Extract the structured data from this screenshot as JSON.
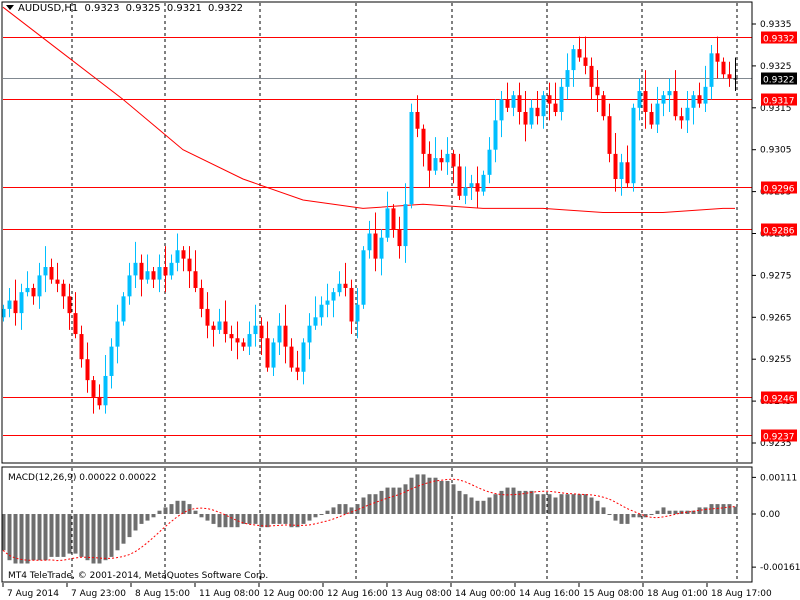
{
  "header": {
    "symbol": "AUDUSD,H1",
    "open": "0.9323",
    "high": "0.9325",
    "low": "0.9321",
    "close": "0.9322"
  },
  "macd_header": "MACD(12,26,9) 0.00022 0.00022",
  "copyright": "MT4 TeleTrade, © 2001-2014, MetaQuotes Software Corp.",
  "colors": {
    "bull": "#00BFFF",
    "bear": "#FF0000",
    "doji": "#000000",
    "level": "#FF0000",
    "current": "#808890",
    "histogram": "#6E6E6E",
    "signal": "#FF0000"
  },
  "chart_data": [
    {
      "type": "candlestick",
      "title": "AUDUSD,H1",
      "ylim": [
        0.9232,
        0.934
      ],
      "y_ticks": [
        "0.9335",
        "0.9325",
        "0.9315",
        "0.9305",
        "0.9295",
        "0.9285",
        "0.9275",
        "0.9265",
        "0.9255",
        "0.9245",
        "0.9235"
      ],
      "x_ticks": [
        "7 Aug 2014",
        "7 Aug 23:00",
        "8 Aug 15:00",
        "11 Aug 08:00",
        "12 Aug 00:00",
        "12 Aug 16:00",
        "13 Aug 08:00",
        "14 Aug 00:00",
        "14 Aug 16:00",
        "15 Aug 08:00",
        "18 Aug 01:00",
        "18 Aug 17:00"
      ],
      "first_open": 0.9265,
      "close": [
        0.9267,
        0.9269,
        0.9266,
        0.9271,
        0.9272,
        0.927,
        0.9275,
        0.9277,
        0.9274,
        0.9273,
        0.927,
        0.9266,
        0.9261,
        0.9255,
        0.925,
        0.9246,
        0.9244,
        0.9251,
        0.9258,
        0.9264,
        0.927,
        0.9275,
        0.9278,
        0.9274,
        0.9276,
        0.9274,
        0.9277,
        0.9275,
        0.9278,
        0.9281,
        0.9279,
        0.9276,
        0.9272,
        0.9267,
        0.9263,
        0.9262,
        0.9264,
        0.9261,
        0.926,
        0.9259,
        0.9258,
        0.9261,
        0.9263,
        0.926,
        0.9253,
        0.9259,
        0.9263,
        0.9258,
        0.9253,
        0.9252,
        0.9259,
        0.9263,
        0.9265,
        0.9268,
        0.9269,
        0.9271,
        0.9273,
        0.9272,
        0.9264,
        0.9268,
        0.9281,
        0.9285,
        0.9279,
        0.9284,
        0.9291,
        0.9286,
        0.9282,
        0.9292,
        0.9314,
        0.931,
        0.9304,
        0.93,
        0.9303,
        0.9302,
        0.9304,
        0.9301,
        0.9294,
        0.9296,
        0.9297,
        0.9295,
        0.9299,
        0.9305,
        0.9312,
        0.9317,
        0.9315,
        0.9318,
        0.9314,
        0.9311,
        0.9315,
        0.9313,
        0.9318,
        0.9316,
        0.9314,
        0.932,
        0.9324,
        0.9329,
        0.9327,
        0.9325,
        0.932,
        0.9318,
        0.9313,
        0.9304,
        0.9298,
        0.9302,
        0.9297,
        0.9315,
        0.9319,
        0.9314,
        0.9311,
        0.9316,
        0.9318,
        0.9319,
        0.9313,
        0.9312,
        0.9315,
        0.9318,
        0.9316,
        0.932,
        0.9328,
        0.9326,
        0.9323,
        0.9322,
        0.9322
      ],
      "moving_average": {
        "sample_every_bars": 10,
        "values": [
          0.9339,
          0.9328,
          0.9317,
          0.9305,
          0.9298,
          0.9293,
          0.9291,
          0.9292,
          0.9291,
          0.9291,
          0.929,
          0.929,
          0.9291,
          0.9291
        ]
      },
      "levels": [
        "0.9332",
        "0.9317",
        "0.9296",
        "0.9286",
        "0.9246",
        "0.9237"
      ],
      "current_price": "0.9322"
    },
    {
      "type": "bar",
      "title": "MACD(12,26,9)",
      "ylim": [
        -0.00161,
        0.00111
      ],
      "y_ticks": [
        "0.00111",
        "0.00",
        "-0.00161"
      ],
      "signal_period": 9,
      "macd": [
        -0.0011,
        -0.0014,
        -0.0015,
        -0.0015,
        -0.0015,
        -0.0014,
        -0.0014,
        -0.0014,
        -0.0013,
        -0.0013,
        -0.0013,
        -0.0012,
        -0.0012,
        -0.0013,
        -0.0014,
        -0.0015,
        -0.0015,
        -0.0014,
        -0.0013,
        -0.0011,
        -0.0009,
        -0.0007,
        -0.0005,
        -0.0003,
        -0.0002,
        -0.0001,
        0.0001,
        0.0002,
        0.0003,
        0.0004,
        0.0004,
        0.0003,
        0.0001,
        -0.0001,
        -0.0002,
        -0.0003,
        -0.0004,
        -0.0004,
        -0.0004,
        -0.0004,
        -0.0003,
        -0.0003,
        -0.0003,
        -0.0004,
        -0.0004,
        -0.0003,
        -0.0003,
        -0.0003,
        -0.0004,
        -0.0004,
        -0.0003,
        -0.0002,
        -0.0001,
        0.0,
        0.0001,
        0.0002,
        0.0003,
        0.0003,
        0.0002,
        0.0003,
        0.0005,
        0.0006,
        0.0006,
        0.0007,
        0.0008,
        0.0008,
        0.0008,
        0.0009,
        0.0011,
        0.0012,
        0.0012,
        0.0011,
        0.0011,
        0.001,
        0.001,
        0.0009,
        0.0007,
        0.0006,
        0.0005,
        0.0004,
        0.0004,
        0.0005,
        0.0006,
        0.0007,
        0.0008,
        0.0008,
        0.0007,
        0.0007,
        0.0007,
        0.0006,
        0.0006,
        0.0006,
        0.0005,
        0.0006,
        0.0006,
        0.0006,
        0.0006,
        0.0006,
        0.0005,
        0.0004,
        0.0002,
        0.0,
        -0.0002,
        -0.0003,
        -0.0003,
        -0.0001,
        -0.0001,
        -0.0001,
        0.0,
        0.0001,
        0.0002,
        0.0001,
        0.0001,
        0.0001,
        0.0001,
        0.0001,
        0.0002,
        0.0002,
        0.0003,
        0.0003,
        0.0003,
        0.0003,
        0.00022
      ]
    }
  ]
}
